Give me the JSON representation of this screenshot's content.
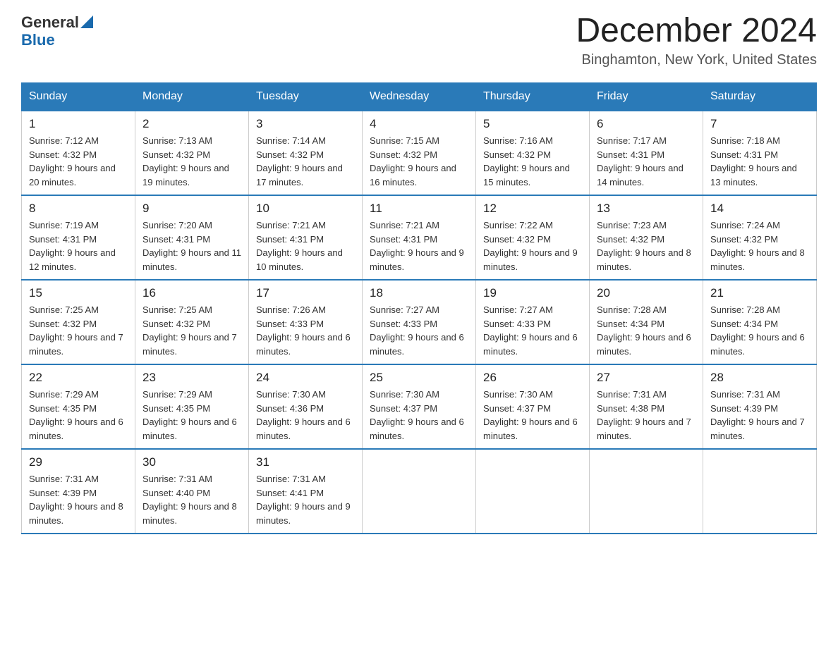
{
  "logo": {
    "general": "General",
    "blue": "Blue"
  },
  "title": "December 2024",
  "subtitle": "Binghamton, New York, United States",
  "days_of_week": [
    "Sunday",
    "Monday",
    "Tuesday",
    "Wednesday",
    "Thursday",
    "Friday",
    "Saturday"
  ],
  "weeks": [
    [
      {
        "day": "1",
        "sunrise": "7:12 AM",
        "sunset": "4:32 PM",
        "daylight": "9 hours and 20 minutes."
      },
      {
        "day": "2",
        "sunrise": "7:13 AM",
        "sunset": "4:32 PM",
        "daylight": "9 hours and 19 minutes."
      },
      {
        "day": "3",
        "sunrise": "7:14 AM",
        "sunset": "4:32 PM",
        "daylight": "9 hours and 17 minutes."
      },
      {
        "day": "4",
        "sunrise": "7:15 AM",
        "sunset": "4:32 PM",
        "daylight": "9 hours and 16 minutes."
      },
      {
        "day": "5",
        "sunrise": "7:16 AM",
        "sunset": "4:32 PM",
        "daylight": "9 hours and 15 minutes."
      },
      {
        "day": "6",
        "sunrise": "7:17 AM",
        "sunset": "4:31 PM",
        "daylight": "9 hours and 14 minutes."
      },
      {
        "day": "7",
        "sunrise": "7:18 AM",
        "sunset": "4:31 PM",
        "daylight": "9 hours and 13 minutes."
      }
    ],
    [
      {
        "day": "8",
        "sunrise": "7:19 AM",
        "sunset": "4:31 PM",
        "daylight": "9 hours and 12 minutes."
      },
      {
        "day": "9",
        "sunrise": "7:20 AM",
        "sunset": "4:31 PM",
        "daylight": "9 hours and 11 minutes."
      },
      {
        "day": "10",
        "sunrise": "7:21 AM",
        "sunset": "4:31 PM",
        "daylight": "9 hours and 10 minutes."
      },
      {
        "day": "11",
        "sunrise": "7:21 AM",
        "sunset": "4:31 PM",
        "daylight": "9 hours and 9 minutes."
      },
      {
        "day": "12",
        "sunrise": "7:22 AM",
        "sunset": "4:32 PM",
        "daylight": "9 hours and 9 minutes."
      },
      {
        "day": "13",
        "sunrise": "7:23 AM",
        "sunset": "4:32 PM",
        "daylight": "9 hours and 8 minutes."
      },
      {
        "day": "14",
        "sunrise": "7:24 AM",
        "sunset": "4:32 PM",
        "daylight": "9 hours and 8 minutes."
      }
    ],
    [
      {
        "day": "15",
        "sunrise": "7:25 AM",
        "sunset": "4:32 PM",
        "daylight": "9 hours and 7 minutes."
      },
      {
        "day": "16",
        "sunrise": "7:25 AM",
        "sunset": "4:32 PM",
        "daylight": "9 hours and 7 minutes."
      },
      {
        "day": "17",
        "sunrise": "7:26 AM",
        "sunset": "4:33 PM",
        "daylight": "9 hours and 6 minutes."
      },
      {
        "day": "18",
        "sunrise": "7:27 AM",
        "sunset": "4:33 PM",
        "daylight": "9 hours and 6 minutes."
      },
      {
        "day": "19",
        "sunrise": "7:27 AM",
        "sunset": "4:33 PM",
        "daylight": "9 hours and 6 minutes."
      },
      {
        "day": "20",
        "sunrise": "7:28 AM",
        "sunset": "4:34 PM",
        "daylight": "9 hours and 6 minutes."
      },
      {
        "day": "21",
        "sunrise": "7:28 AM",
        "sunset": "4:34 PM",
        "daylight": "9 hours and 6 minutes."
      }
    ],
    [
      {
        "day": "22",
        "sunrise": "7:29 AM",
        "sunset": "4:35 PM",
        "daylight": "9 hours and 6 minutes."
      },
      {
        "day": "23",
        "sunrise": "7:29 AM",
        "sunset": "4:35 PM",
        "daylight": "9 hours and 6 minutes."
      },
      {
        "day": "24",
        "sunrise": "7:30 AM",
        "sunset": "4:36 PM",
        "daylight": "9 hours and 6 minutes."
      },
      {
        "day": "25",
        "sunrise": "7:30 AM",
        "sunset": "4:37 PM",
        "daylight": "9 hours and 6 minutes."
      },
      {
        "day": "26",
        "sunrise": "7:30 AM",
        "sunset": "4:37 PM",
        "daylight": "9 hours and 6 minutes."
      },
      {
        "day": "27",
        "sunrise": "7:31 AM",
        "sunset": "4:38 PM",
        "daylight": "9 hours and 7 minutes."
      },
      {
        "day": "28",
        "sunrise": "7:31 AM",
        "sunset": "4:39 PM",
        "daylight": "9 hours and 7 minutes."
      }
    ],
    [
      {
        "day": "29",
        "sunrise": "7:31 AM",
        "sunset": "4:39 PM",
        "daylight": "9 hours and 8 minutes."
      },
      {
        "day": "30",
        "sunrise": "7:31 AM",
        "sunset": "4:40 PM",
        "daylight": "9 hours and 8 minutes."
      },
      {
        "day": "31",
        "sunrise": "7:31 AM",
        "sunset": "4:41 PM",
        "daylight": "9 hours and 9 minutes."
      },
      null,
      null,
      null,
      null
    ]
  ]
}
